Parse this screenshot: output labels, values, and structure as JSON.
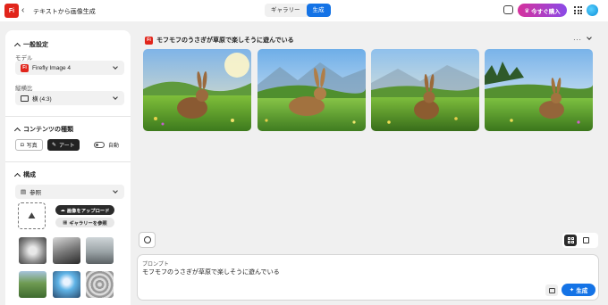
{
  "app": {
    "logo_text": "Fi",
    "title": "テキストから画像生成"
  },
  "header": {
    "tabs": [
      {
        "label": "ギャラリー",
        "active": false
      },
      {
        "label": "生成",
        "active": true
      }
    ],
    "buy_label": "今すぐ購入",
    "icons": [
      "back-chevron-icon",
      "chat-icon",
      "app-grid-icon",
      "avatar"
    ]
  },
  "sidebar": {
    "general": {
      "title": "一般設定",
      "model_label": "モデル",
      "model_value": "Firefly Image 4",
      "ratio_label": "縦横比",
      "ratio_value": "横 (4:3)"
    },
    "content_type": {
      "title": "コンテンツの種類",
      "options": [
        {
          "label": "写真",
          "selected": false
        },
        {
          "label": "アート",
          "selected": true
        }
      ],
      "auto_label": "自動",
      "auto_on": false
    },
    "composition": {
      "title": "構成",
      "reference_value": "参照",
      "upload_label": "画像をアップロード",
      "browse_label": "ギャラリーを参照"
    }
  },
  "main": {
    "prompt_title": "モフモフのうさぎが草原で楽しそうに遊んでいる",
    "more_label": "···",
    "images_count": 4
  },
  "prompt_box": {
    "label": "プロンプト",
    "text": "モフモフのうさぎが草原で楽しそうに遊んでいる",
    "generate_label": "生成"
  },
  "colors": {
    "accent": "#1473e6",
    "brand": "#e1251b",
    "buy_gradient_start": "#d6319c",
    "buy_gradient_end": "#8a4ae8"
  }
}
